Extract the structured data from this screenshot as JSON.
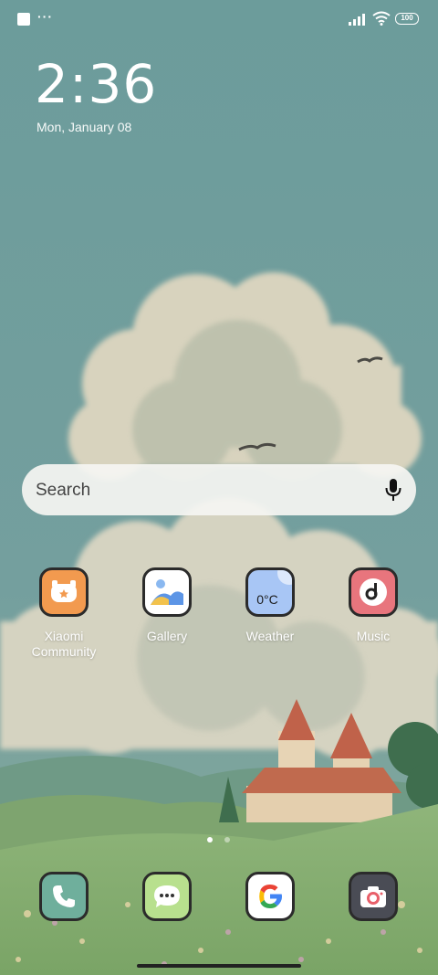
{
  "status_bar": {
    "notification_icon": "square-notification-icon",
    "more_indicator": "···",
    "signal_icon": "signal-bars-icon",
    "wifi_icon": "wifi-icon",
    "battery_level": "100"
  },
  "lockclock": {
    "time": "2:36",
    "date": "Mon, January 08"
  },
  "search": {
    "placeholder": "Search",
    "mic_icon": "microphone-icon"
  },
  "apps": [
    {
      "label_line1": "Xiaomi",
      "label_line2": "Community",
      "icon": "xiaomi-community-icon",
      "color": "#F29A4F"
    },
    {
      "label_line1": "Gallery",
      "label_line2": "",
      "icon": "gallery-icon",
      "color": "#FFFFFF"
    },
    {
      "label_line1": "Weather",
      "label_line2": "",
      "icon": "weather-icon",
      "color": "#A8C6F5",
      "icon_text": "0°C"
    },
    {
      "label_line1": "Music",
      "label_line2": "",
      "icon": "music-icon",
      "color": "#E8757D"
    }
  ],
  "dock": [
    {
      "icon": "phone-icon",
      "color": "#6FAF9C"
    },
    {
      "icon": "messages-icon",
      "color": "#B8E08E"
    },
    {
      "icon": "google-icon",
      "color": "#FFFFFF"
    },
    {
      "icon": "camera-icon",
      "color": "#4A4C55"
    }
  ],
  "page_indicator": {
    "pages": 2,
    "current": 1
  },
  "colors": {
    "sky": "#6E9E9D",
    "cloud": "#D9D5C2",
    "search_bg": "#F5F5F2"
  }
}
